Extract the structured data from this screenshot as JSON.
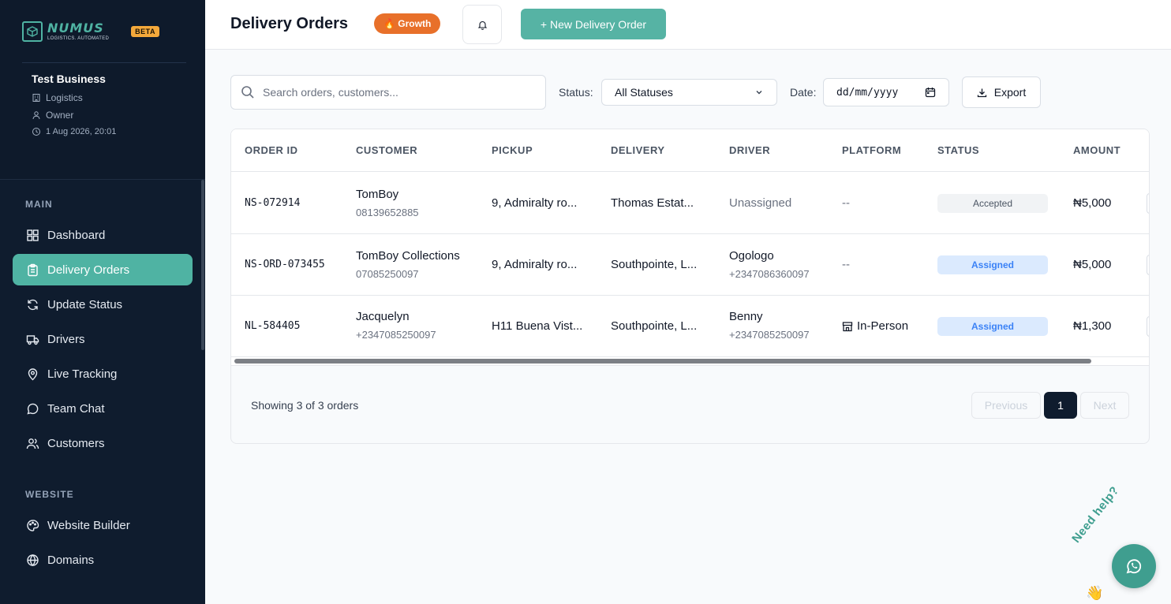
{
  "brand": {
    "name": "NUMUS",
    "tagline": "LOGISTICS. AUTOMATED",
    "badge": "BETA"
  },
  "business": {
    "name": "Test Business",
    "type": "Logistics",
    "role": "Owner",
    "datetime": "1 Aug 2026, 20:01"
  },
  "nav": {
    "main_title": "MAIN",
    "main_items": [
      {
        "label": "Dashboard",
        "icon": "grid-icon"
      },
      {
        "label": "Delivery Orders",
        "icon": "clipboard-icon",
        "active": true
      },
      {
        "label": "Update Status",
        "icon": "refresh-icon"
      },
      {
        "label": "Drivers",
        "icon": "truck-icon"
      },
      {
        "label": "Live Tracking",
        "icon": "map-pin-icon"
      },
      {
        "label": "Team Chat",
        "icon": "chat-icon"
      },
      {
        "label": "Customers",
        "icon": "users-icon"
      }
    ],
    "website_title": "WEBSITE",
    "website_items": [
      {
        "label": "Website Builder",
        "icon": "palette-icon"
      },
      {
        "label": "Domains",
        "icon": "globe-icon"
      }
    ]
  },
  "header": {
    "title": "Delivery Orders",
    "plan_badge": "🔥 Growth",
    "new_button": "+ New Delivery Order"
  },
  "filters": {
    "search_placeholder": "Search orders, customers...",
    "status_label": "Status:",
    "status_value": "All Statuses",
    "date_label": "Date:",
    "date_placeholder": "dd/mm/yyyy",
    "export_label": "Export"
  },
  "table": {
    "columns": [
      "ORDER ID",
      "CUSTOMER",
      "PICKUP",
      "DELIVERY",
      "DRIVER",
      "PLATFORM",
      "STATUS",
      "AMOUNT"
    ],
    "rows": [
      {
        "order_id": "NS-072914",
        "customer": "TomBoy",
        "customer_phone": "08139652885",
        "pickup": "9, Admiralty ro...",
        "delivery": "Thomas Estat...",
        "driver": "Unassigned",
        "driver_phone": "",
        "platform": "--",
        "status": "Accepted",
        "amount": "₦5,000"
      },
      {
        "order_id": "NS-ORD-073455",
        "customer": "TomBoy Collections",
        "customer_phone": "07085250097",
        "pickup": "9, Admiralty ro...",
        "delivery": "Southpointe, L...",
        "driver": "Ogologo",
        "driver_phone": "+2347086360097",
        "platform": "--",
        "status": "Assigned",
        "amount": "₦5,000"
      },
      {
        "order_id": "NL-584405",
        "customer": "Jacquelyn",
        "customer_phone": "+2347085250097",
        "pickup": "H11 Buena Vist...",
        "delivery": "Southpointe, L...",
        "driver": "Benny",
        "driver_phone": "+2347085250097",
        "platform": "In-Person",
        "status": "Assigned",
        "amount": "₦1,300"
      }
    ]
  },
  "pagination": {
    "summary": "Showing 3 of 3 orders",
    "prev": "Previous",
    "current": "1",
    "next": "Next"
  },
  "help": {
    "text": "Need help?",
    "wave": "👋"
  },
  "colors": {
    "accent": "#4fb3a3",
    "sidebar": "#0f1c2e",
    "growth": "#e8702a",
    "beta": "#f4a93b"
  }
}
